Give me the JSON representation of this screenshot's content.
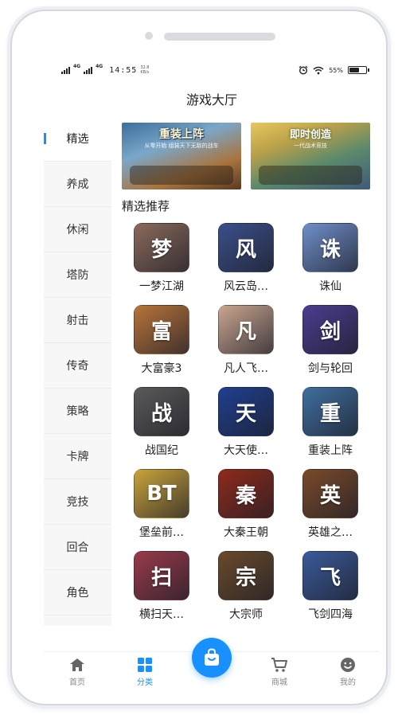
{
  "status_bar": {
    "network_1": "4G",
    "network_2": "4G",
    "time": "14:55",
    "speed_value": "32.8",
    "speed_unit": "KB/s",
    "battery_text": "55%",
    "battery_level": 0.55
  },
  "page": {
    "title": "游戏大厅"
  },
  "sidebar": {
    "active_index": 0,
    "items": [
      {
        "label": "精选"
      },
      {
        "label": "养成"
      },
      {
        "label": "休闲"
      },
      {
        "label": "塔防"
      },
      {
        "label": "射击"
      },
      {
        "label": "传奇"
      },
      {
        "label": "策略"
      },
      {
        "label": "卡牌"
      },
      {
        "label": "竞技"
      },
      {
        "label": "回合"
      },
      {
        "label": "角色"
      }
    ]
  },
  "banners": [
    {
      "title": "重装上阵",
      "subtitle": "从零开始 组装天下无敌的战车"
    },
    {
      "title": "即时创造",
      "subtitle": "一代战术竞技"
    }
  ],
  "section": {
    "title": "精选推荐"
  },
  "apps": [
    {
      "name": "一梦江湖",
      "glyph": "梦",
      "color": "#8a6a5a"
    },
    {
      "name": "风云岛…",
      "glyph": "风",
      "color": "#3a4f8a"
    },
    {
      "name": "诛仙",
      "glyph": "诛",
      "color": "#6f8fc9"
    },
    {
      "name": "大富豪3",
      "glyph": "富",
      "color": "#b8743a"
    },
    {
      "name": "凡人飞…",
      "glyph": "凡",
      "color": "#c9a58f"
    },
    {
      "name": "剑与轮回",
      "glyph": "剑",
      "color": "#4b3c8f"
    },
    {
      "name": "战国纪",
      "glyph": "战",
      "color": "#5a5a5a"
    },
    {
      "name": "大天使…",
      "glyph": "天",
      "color": "#1f3f8f"
    },
    {
      "name": "重装上阵",
      "glyph": "重",
      "color": "#3f6f9f"
    },
    {
      "name": "堡垒前…",
      "glyph": "BT",
      "color": "#c9a33a"
    },
    {
      "name": "大秦王朝",
      "glyph": "秦",
      "color": "#8f2a1a"
    },
    {
      "name": "英雄之…",
      "glyph": "英",
      "color": "#7a4a2a"
    },
    {
      "name": "横扫天…",
      "glyph": "扫",
      "color": "#9a3a4a"
    },
    {
      "name": "大宗师",
      "glyph": "宗",
      "color": "#6a4a2a"
    },
    {
      "name": "飞剑四海",
      "glyph": "飞",
      "color": "#3a5a9a"
    }
  ],
  "tabbar": {
    "active": "分类",
    "tabs": [
      {
        "label": "首页",
        "icon": "home-icon"
      },
      {
        "label": "分类",
        "icon": "grid-icon"
      },
      {
        "label": "商城",
        "icon": "cart-icon"
      },
      {
        "label": "我的",
        "icon": "smile-icon"
      }
    ],
    "center_button_icon": "shopping-bag-icon"
  },
  "colors": {
    "accent": "#1890ff",
    "sidebar_bg": "#f7f7f8"
  }
}
